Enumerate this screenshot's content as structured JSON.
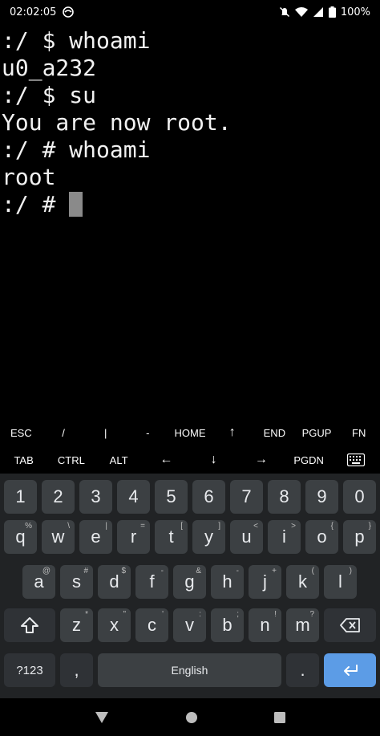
{
  "status": {
    "time": "02:02:05",
    "battery": "100%"
  },
  "terminal": {
    "lines": [
      ":/ $ whoami",
      "u0_a232",
      ":/ $ su",
      "You are now root.",
      ":/ # whoami",
      "root"
    ],
    "prompt": ":/ # "
  },
  "extra_keys": {
    "row1": [
      "ESC",
      "/",
      "|",
      "-",
      "HOME",
      "↑",
      "END",
      "PGUP",
      "FN"
    ],
    "row2": [
      "TAB",
      "CTRL",
      "ALT",
      "←",
      "↓",
      "→",
      "PGDN"
    ]
  },
  "keyboard": {
    "numbers": [
      "1",
      "2",
      "3",
      "4",
      "5",
      "6",
      "7",
      "8",
      "9",
      "0"
    ],
    "row_q": [
      "q",
      "w",
      "e",
      "r",
      "t",
      "y",
      "u",
      "i",
      "o",
      "p"
    ],
    "row_q_hints": [
      "%",
      "\\",
      "|",
      "=",
      "[",
      "]",
      "<",
      ">",
      "{",
      "}"
    ],
    "row_a": [
      "a",
      "s",
      "d",
      "f",
      "g",
      "h",
      "j",
      "k",
      "l"
    ],
    "row_a_hints": [
      "@",
      "#",
      "$",
      "-",
      "&",
      "-",
      "+",
      "(",
      ")"
    ],
    "row_z": [
      "z",
      "x",
      "c",
      "v",
      "b",
      "n",
      "m"
    ],
    "row_z_hints": [
      "*",
      "\"",
      "'",
      ":",
      ";",
      "!",
      "?"
    ],
    "symbols_label": "?123",
    "comma": ",",
    "space_label": "English",
    "period": "."
  },
  "colors": {
    "keyboard_bg": "#212325",
    "key_bg": "#3c4043",
    "enter_bg": "#5c9ce6"
  }
}
